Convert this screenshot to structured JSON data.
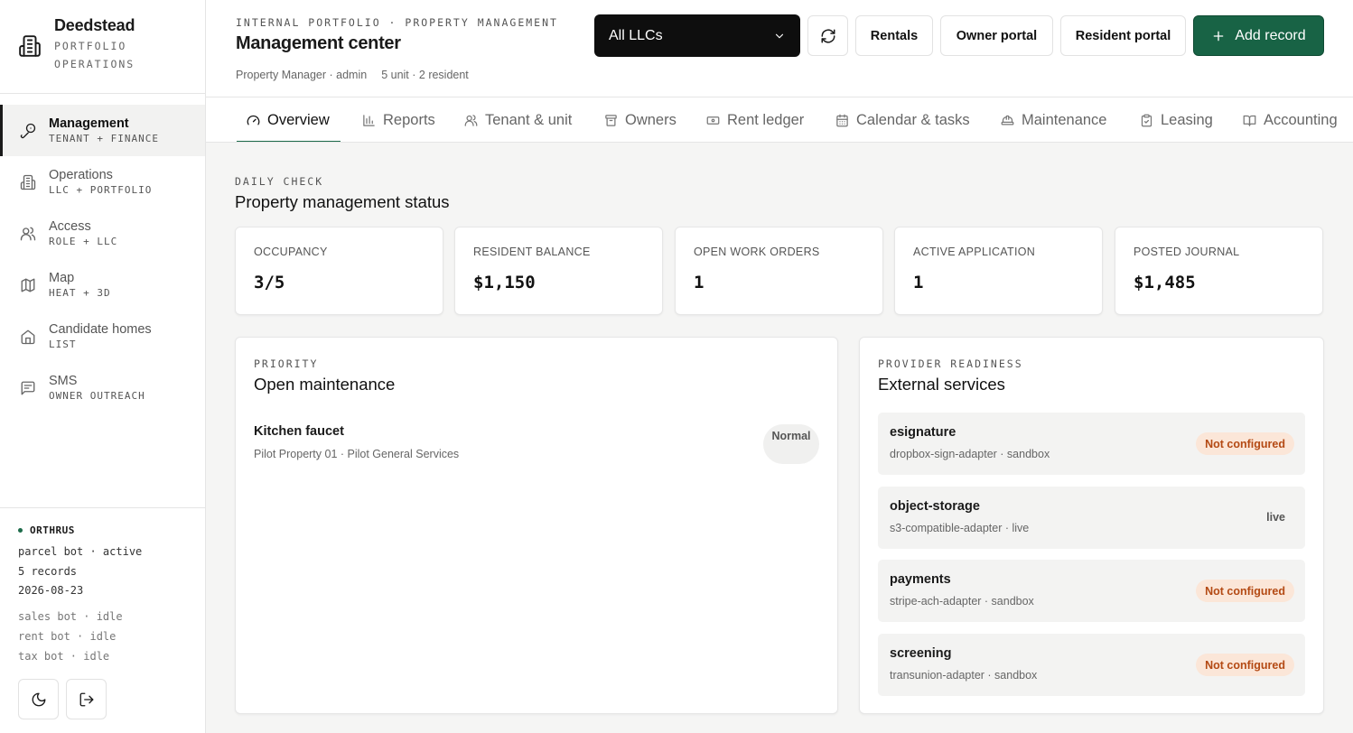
{
  "brand": {
    "name": "Deedstead",
    "sub_line1": "PORTFOLIO",
    "sub_line2": "OPERATIONS"
  },
  "sidebar": {
    "items": [
      {
        "label": "Management",
        "sub": "TENANT + FINANCE",
        "icon": "key-icon",
        "active": true
      },
      {
        "label": "Operations",
        "sub": "LLC + PORTFOLIO",
        "icon": "building-icon",
        "active": false
      },
      {
        "label": "Access",
        "sub": "ROLE + LLC",
        "icon": "users-icon",
        "active": false
      },
      {
        "label": "Map",
        "sub": "HEAT + 3D",
        "icon": "map-icon",
        "active": false
      },
      {
        "label": "Candidate homes",
        "sub": "LIST",
        "icon": "home-icon",
        "active": false
      },
      {
        "label": "SMS",
        "sub": "OWNER OUTREACH",
        "icon": "message-icon",
        "active": false
      }
    ]
  },
  "bot_panel": {
    "title": "ORTHRUS",
    "status_lines": [
      "parcel bot · active",
      "5 records",
      "2026-08-23"
    ],
    "idle_lines": [
      "sales bot · idle",
      "rent bot · idle",
      "tax bot · idle"
    ]
  },
  "header": {
    "eyebrow": "INTERNAL PORTFOLIO · PROPERTY MANAGEMENT",
    "title": "Management center",
    "meta_user": "Property Manager · admin",
    "meta_counts": "5 unit · 2 resident",
    "llc_select": "All LLCs",
    "buttons": {
      "rentals": "Rentals",
      "owner_portal": "Owner portal",
      "resident_portal": "Resident portal",
      "add_record": "Add record"
    }
  },
  "tabs": [
    {
      "label": "Overview",
      "icon": "gauge-icon",
      "active": true
    },
    {
      "label": "Reports",
      "icon": "bar-chart-icon",
      "active": false
    },
    {
      "label": "Tenant & unit",
      "icon": "users-icon",
      "active": false
    },
    {
      "label": "Owners",
      "icon": "archive-icon",
      "active": false
    },
    {
      "label": "Rent ledger",
      "icon": "banknote-icon",
      "active": false
    },
    {
      "label": "Calendar & tasks",
      "icon": "calendar-icon",
      "active": false
    },
    {
      "label": "Maintenance",
      "icon": "hard-hat-icon",
      "active": false
    },
    {
      "label": "Leasing",
      "icon": "clipboard-icon",
      "active": false
    },
    {
      "label": "Accounting",
      "icon": "book-icon",
      "active": false
    }
  ],
  "status": {
    "eyebrow": "DAILY CHECK",
    "title": "Property management status",
    "stats": [
      {
        "label": "OCCUPANCY",
        "value": "3/5"
      },
      {
        "label": "RESIDENT BALANCE",
        "value": "$1,150"
      },
      {
        "label": "OPEN WORK ORDERS",
        "value": "1"
      },
      {
        "label": "ACTIVE APPLICATION",
        "value": "1"
      },
      {
        "label": "POSTED JOURNAL",
        "value": "$1,485"
      }
    ]
  },
  "maintenance": {
    "eyebrow": "PRIORITY",
    "title": "Open maintenance",
    "item": {
      "title": "Kitchen faucet",
      "sub": "Pilot Property 01 · Pilot General Services",
      "priority": "Normal"
    }
  },
  "services": {
    "eyebrow": "PROVIDER READINESS",
    "title": "External services",
    "items": [
      {
        "name": "esignature",
        "sub": "dropbox-sign-adapter · sandbox",
        "status": "Not configured"
      },
      {
        "name": "object-storage",
        "sub": "s3-compatible-adapter · live",
        "status": "live"
      },
      {
        "name": "payments",
        "sub": "stripe-ach-adapter · sandbox",
        "status": "Not configured"
      },
      {
        "name": "screening",
        "sub": "transunion-adapter · sandbox",
        "status": "Not configured"
      }
    ]
  },
  "colors": {
    "accent": "#186345",
    "warn_bg": "#fbe6d8",
    "warn_text": "#b44a14"
  }
}
